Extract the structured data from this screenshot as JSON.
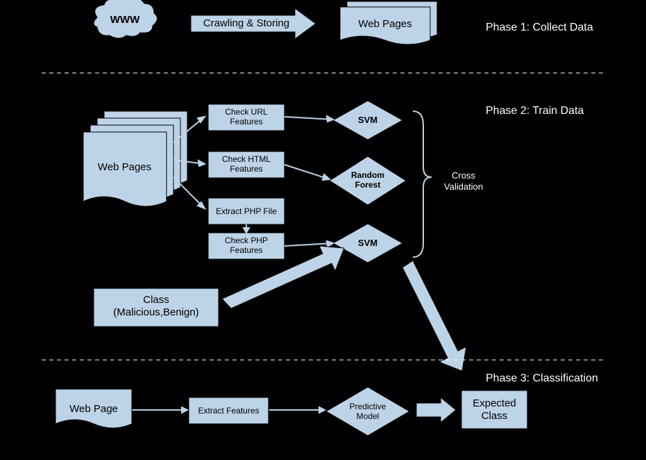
{
  "www": "WWW",
  "crawl": "Crawling & Storing",
  "webpages": "Web Pages",
  "ch_url": "Check URL Features",
  "ch_html": "Check HTML Features",
  "ex_php": "Extract PHP File",
  "ch_php": "Check PHP Features",
  "svm1": "SVM",
  "rf": "Random\nForest",
  "svm2": "SVM",
  "klass": "Class\n(Malicious,Benign)",
  "crossval": "Cross\nValidation",
  "webpage": "Web Page",
  "ex_feat": "Extract Features",
  "predmodel": "Predictive\nModel",
  "expected": "Expected\nClass",
  "phase1": "Phase 1:  Collect Data",
  "phase2": "Phase 2:  Train Data",
  "phase3": "Phase 3:  Classification"
}
